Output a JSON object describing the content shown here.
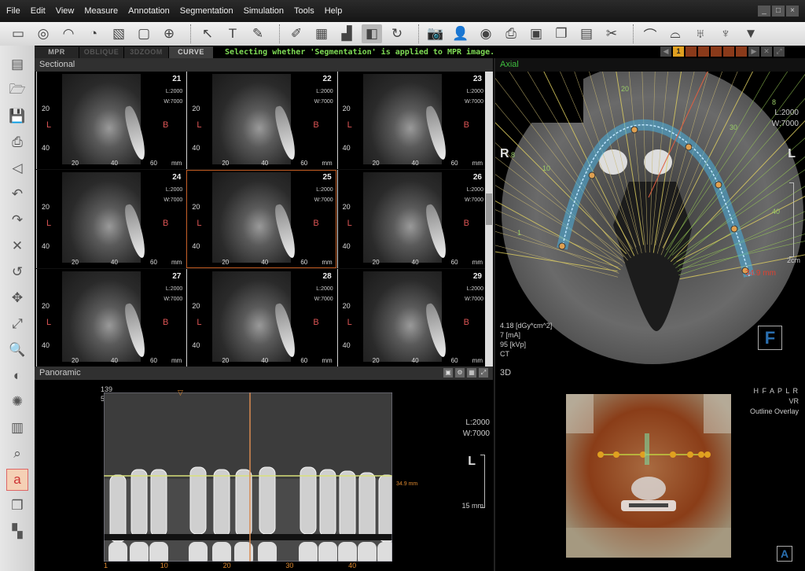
{
  "menu": [
    "File",
    "Edit",
    "View",
    "Measure",
    "Annotation",
    "Segmentation",
    "Simulation",
    "Tools",
    "Help"
  ],
  "window_controls": [
    "_",
    "□",
    "×"
  ],
  "toolbar": [
    {
      "name": "ruler-icon",
      "g": "▭"
    },
    {
      "name": "tape-measure-icon",
      "g": "◎"
    },
    {
      "name": "arch-icon",
      "g": "◠"
    },
    {
      "name": "arch-3d-icon",
      "g": "◔"
    },
    {
      "name": "profile-icon",
      "g": "▧"
    },
    {
      "name": "roi-icon",
      "g": "▢"
    },
    {
      "name": "grid-icon",
      "g": "⊕"
    },
    {
      "sep": true
    },
    {
      "name": "pointer-icon",
      "g": "↖"
    },
    {
      "name": "text-icon",
      "g": "T"
    },
    {
      "name": "pen-icon",
      "g": "✎"
    },
    {
      "sep": true
    },
    {
      "name": "edit-image-icon",
      "g": "✐"
    },
    {
      "name": "select-image-icon",
      "g": "▦"
    },
    {
      "name": "histogram-icon",
      "g": "▟"
    },
    {
      "name": "segmentation-overlay-icon",
      "g": "◧",
      "active": true
    },
    {
      "name": "rotate-volume-icon",
      "g": "↻"
    },
    {
      "sep": true
    },
    {
      "name": "camera-icon",
      "g": "📷"
    },
    {
      "name": "patient-icon",
      "g": "👤"
    },
    {
      "name": "disc-icon",
      "g": "◉"
    },
    {
      "name": "export-icon",
      "g": "⎙"
    },
    {
      "name": "import-icon",
      "g": "▣"
    },
    {
      "name": "copy-icon",
      "g": "❐"
    },
    {
      "name": "layout-icon",
      "g": "▤"
    },
    {
      "name": "tools-icon",
      "g": "✂"
    },
    {
      "sep": true
    },
    {
      "name": "curve-icon",
      "g": "⌒"
    },
    {
      "name": "curve-m-icon",
      "g": "⌓"
    },
    {
      "name": "teeth-icon",
      "g": "♅"
    },
    {
      "name": "teeth-m-icon",
      "g": "♆"
    },
    {
      "name": "implant-icon",
      "g": "▼"
    }
  ],
  "left_toolbar": [
    {
      "name": "open-icon",
      "g": "▤"
    },
    {
      "name": "open-folder-icon",
      "g": "🗁"
    },
    {
      "name": "save-icon",
      "g": "💾"
    },
    {
      "name": "print-icon",
      "g": "⎙"
    },
    {
      "name": "angle-icon",
      "g": "◁"
    },
    {
      "name": "undo-icon",
      "g": "↶"
    },
    {
      "name": "redo-icon",
      "g": "↷"
    },
    {
      "name": "delete-icon",
      "g": "✕"
    },
    {
      "name": "rotate-icon",
      "g": "↺"
    },
    {
      "name": "pan-icon",
      "g": "✥"
    },
    {
      "name": "adjust-icon",
      "g": "⤢"
    },
    {
      "name": "zoom-icon",
      "g": "🔍"
    },
    {
      "name": "contrast-icon",
      "g": "◐"
    },
    {
      "name": "brightness-icon",
      "g": "✺"
    },
    {
      "name": "gradient-icon",
      "g": "▥"
    },
    {
      "name": "magnifier-icon",
      "g": "⌕"
    },
    {
      "name": "annotation-icon",
      "g": "a",
      "on": true
    },
    {
      "name": "cube-icon",
      "g": "❒"
    },
    {
      "name": "checker-icon",
      "g": "▚"
    }
  ],
  "tabs": [
    "MPR",
    "OBLIQUE",
    "3DZOOM",
    "CURVE"
  ],
  "active_tab": "CURVE",
  "status_message": "Selecting whether 'Segmentation' is applied to MPR image.",
  "page_nav": {
    "current": "1"
  },
  "sectional": {
    "title": "Sectional",
    "level": "L:2000",
    "width": "W:7000",
    "left_label": "L",
    "right_label": "B",
    "y_ticks": [
      "20",
      "40"
    ],
    "x_ticks": [
      "20",
      "40",
      "60"
    ],
    "unit": "mm",
    "slices": [
      "21",
      "22",
      "23",
      "24",
      "25",
      "26",
      "27",
      "28",
      "29"
    ],
    "selected": "25"
  },
  "axial": {
    "title": "Axial",
    "level": "L:2000",
    "width": "W:7000",
    "left_orient": "R",
    "right_orient": "L",
    "arch_labels": [
      "20",
      "30",
      "10",
      "40",
      "1",
      "8",
      "8"
    ],
    "measure": "34.9 mm",
    "scale": "2cm",
    "dose": "4.18 [dGy*cm^2]",
    "current": "7 [mA]",
    "voltage": "95 [kVp]",
    "modality": "CT",
    "view_badge": "F"
  },
  "panoramic": {
    "title": "Panoramic",
    "top_labels": [
      "139",
      "5Y"
    ],
    "level": "L:2000",
    "width": "W:7000",
    "orient": "L",
    "scale": "15 mm",
    "measure": "34.9 mm",
    "x_ticks": [
      "1",
      "10",
      "20",
      "30",
      "40"
    ]
  },
  "three_d": {
    "title": "3D",
    "orient": "H F A P L R",
    "mode": "VR",
    "overlay": "Outline Overlay",
    "view_badge": "A"
  },
  "colors": {
    "accent": "#e08a30",
    "status": "#7fdc55",
    "arch": "#4ab0e0",
    "marker": "#d55"
  }
}
